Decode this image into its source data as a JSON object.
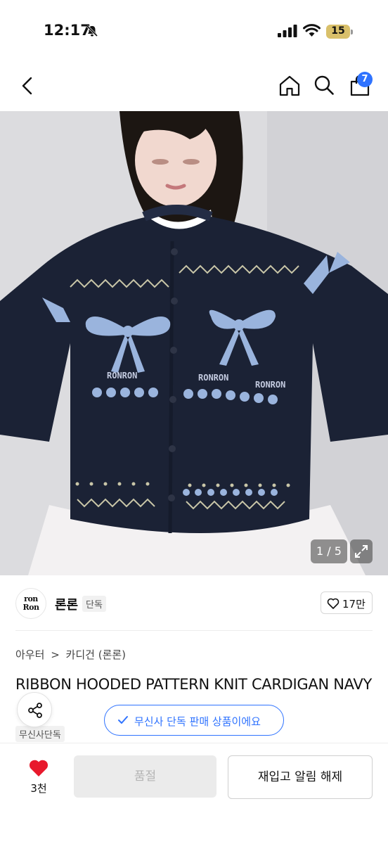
{
  "status_bar": {
    "time": "12:17",
    "battery": "15"
  },
  "nav": {
    "cart_count": "7"
  },
  "gallery": {
    "counter": "1 / 5"
  },
  "brand": {
    "logo_text_line1": "ron",
    "logo_text_line2": "Ron",
    "name": "론론",
    "tag": "단독"
  },
  "likes": {
    "count": "17만"
  },
  "breadcrumb": {
    "level1": "아우터",
    "separator": ">",
    "level2": "카디건 (론론)"
  },
  "product": {
    "title": "RIBBON HOODED PATTERN KNIT CARDIGAN NAVY",
    "tag": "무신사단독",
    "exclusive_notice": "무신사 단독 판매 상품이에요"
  },
  "artwork_text": {
    "knit_label": "RONRON"
  },
  "bottom_bar": {
    "wish_count": "3천",
    "soldout_label": "품절",
    "restock_label": "재입고 알림 해제"
  },
  "colors": {
    "accent": "#2f73ff",
    "heart": "#e8192c",
    "sweater": "#1b2235",
    "pattern": "#9ab4dd"
  }
}
